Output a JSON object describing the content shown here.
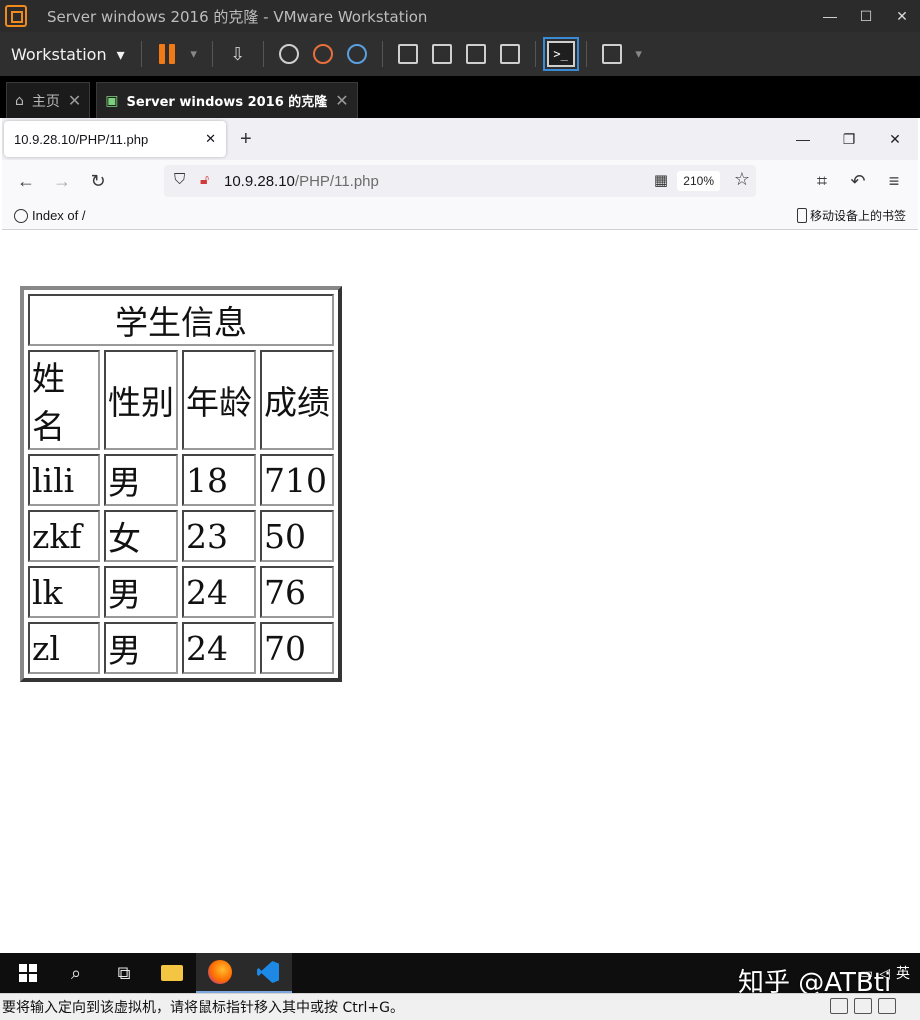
{
  "vmware": {
    "title": "Server windows 2016 的克隆 - VMware Workstation",
    "menu_label": "Workstation",
    "tabs": [
      {
        "label": "主页"
      },
      {
        "label": "Server windows 2016 的克隆"
      }
    ],
    "status_text": "要将输入定向到该虚拟机，请将鼠标指针移入其中或按 Ctrl+G。"
  },
  "browser": {
    "tab_title": "10.9.28.10/PHP/11.php",
    "url_host": "10.9.28.10",
    "url_path": "/PHP/11.php",
    "zoom": "210%",
    "bookmark_left": "Index of /",
    "bookmark_right": "移动设备上的书签"
  },
  "page": {
    "table": {
      "caption": "学生信息",
      "headers": [
        "姓名",
        "性别",
        "年龄",
        "成绩"
      ],
      "rows": [
        [
          "lili",
          "男",
          "18",
          "710"
        ],
        [
          "zkf",
          "女",
          "23",
          "50"
        ],
        [
          "lk",
          "男",
          "24",
          "76"
        ],
        [
          "zl",
          "男",
          "24",
          "70"
        ]
      ]
    }
  },
  "taskbar": {
    "tray_lang": "英",
    "watermark": "知乎 @ATBti"
  },
  "colors": {
    "vmware_accent": "#f07a16",
    "taskbar_bg": "#0e0e0e",
    "firefox_chrome": "#f9f9fb"
  }
}
